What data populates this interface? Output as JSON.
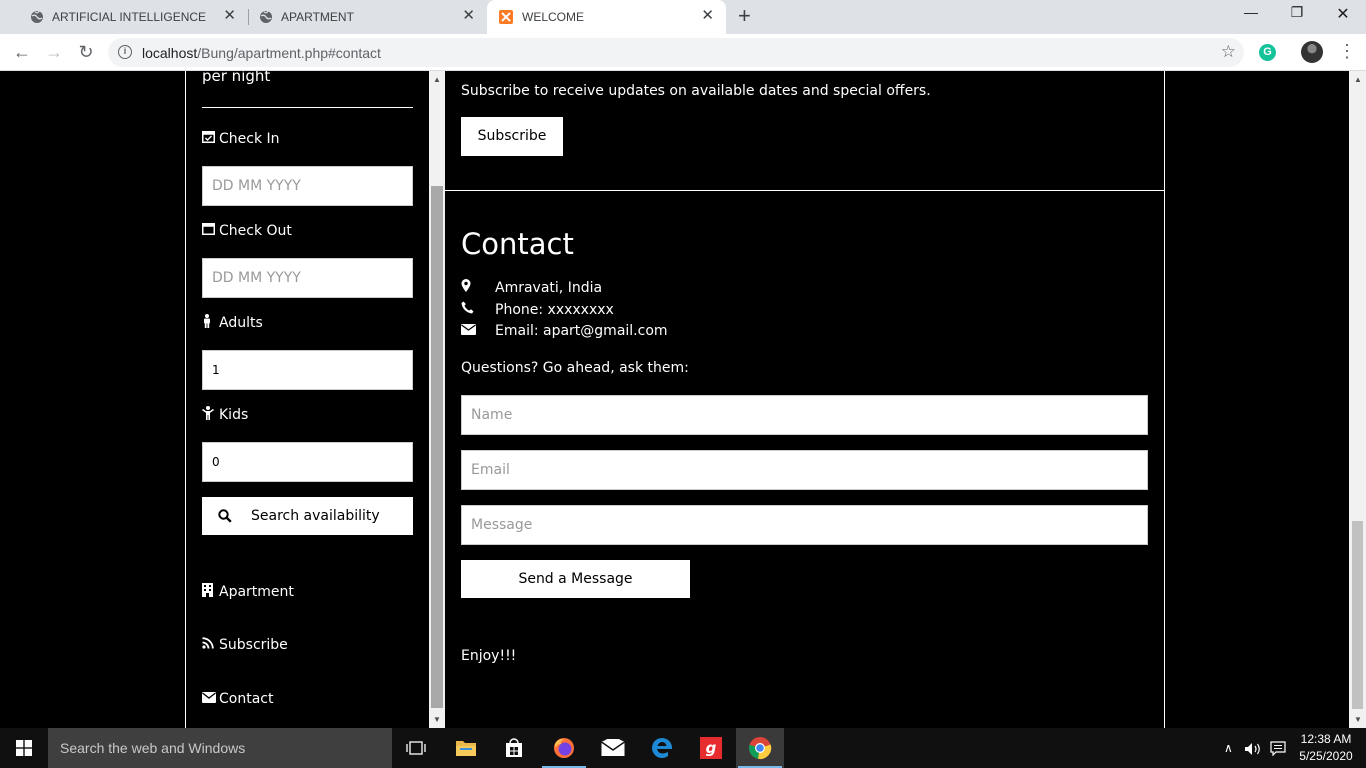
{
  "browser": {
    "tabs": [
      {
        "title": "ARTIFICIAL INTELLIGENCE",
        "icon": "globe-icon"
      },
      {
        "title": "APARTMENT",
        "icon": "globe-icon"
      },
      {
        "title": "WELCOME",
        "icon": "xampp-icon",
        "active": true
      }
    ],
    "url_host": "localhost",
    "url_path": "/Bung/apartment.php#contact",
    "extension_letter": "G"
  },
  "sidebar": {
    "per_night": "per night",
    "check_in_label": "Check In",
    "check_in_placeholder": "DD MM YYYY",
    "check_out_label": "Check Out",
    "check_out_placeholder": "DD MM YYYY",
    "adults_label": "Adults",
    "adults_value": "1",
    "kids_label": "Kids",
    "kids_value": "0",
    "search_label": "Search availability",
    "nav": [
      {
        "label": "Apartment",
        "icon": "building-icon"
      },
      {
        "label": "Subscribe",
        "icon": "rss-icon"
      },
      {
        "label": "Contact",
        "icon": "envelope-icon"
      }
    ]
  },
  "main": {
    "subscribe_text": "Subscribe to receive updates on available dates and special offers.",
    "subscribe_button": "Subscribe",
    "contact_heading": "Contact",
    "location": "Amravati, India",
    "phone": "Phone: xxxxxxxx",
    "email": "Email: apart@gmail.com",
    "questions": "Questions? Go ahead, ask them:",
    "name_placeholder": "Name",
    "email_placeholder": "Email",
    "message_placeholder": "Message",
    "send_button": "Send a Message",
    "enjoy": "Enjoy!!!"
  },
  "taskbar": {
    "search_placeholder": "Search the web and Windows",
    "time": "12:38 AM",
    "date": "5/25/2020"
  },
  "colors": {
    "page_bg": "#000000",
    "text": "#ffffff",
    "chrome_bg": "#dee1e6",
    "taskbar_bg": "#101010"
  }
}
